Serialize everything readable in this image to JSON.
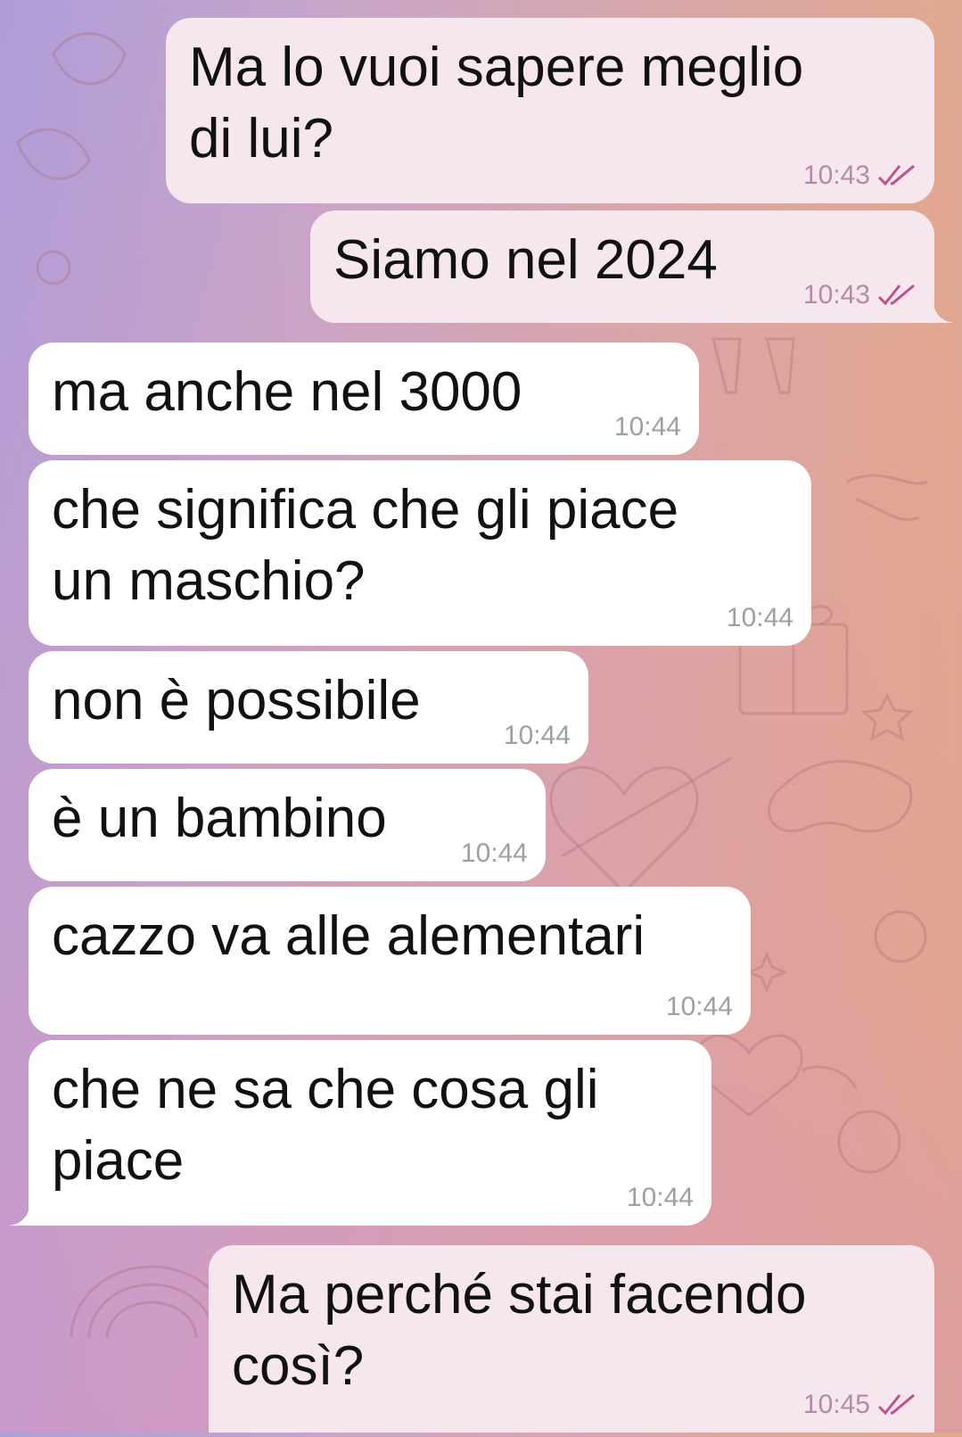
{
  "chat": {
    "messages": [
      {
        "text": "Ma lo vuoi sapere meglio\ndi lui?",
        "time": "10:43",
        "direction": "outgoing",
        "read": true
      },
      {
        "text": "Siamo nel 2024",
        "time": "10:43",
        "direction": "outgoing",
        "read": true
      },
      {
        "text": "ma anche nel 3000",
        "time": "10:44",
        "direction": "incoming"
      },
      {
        "text": "che significa che gli piace\nun maschio?",
        "time": "10:44",
        "direction": "incoming"
      },
      {
        "text": "non è possibile",
        "time": "10:44",
        "direction": "incoming"
      },
      {
        "text": "è un bambino",
        "time": "10:44",
        "direction": "incoming"
      },
      {
        "text": "cazzo va alle alementari",
        "time": "10:44",
        "direction": "incoming"
      },
      {
        "text": "che ne sa che cosa gli\npiace",
        "time": "10:44",
        "direction": "incoming"
      },
      {
        "text": "Ma perché stai facendo\ncosì?",
        "time": "10:45",
        "direction": "outgoing",
        "read": true
      }
    ]
  },
  "colors": {
    "incoming_bubble": "#ffffff",
    "outgoing_bubble": "#f6e7ef",
    "read_check": "#c0508e",
    "incoming_time": "#9aa0a6",
    "outgoing_time": "#b48aa6"
  },
  "icons": {
    "read_receipt": "double-check-icon",
    "background": "doodle-pattern"
  }
}
